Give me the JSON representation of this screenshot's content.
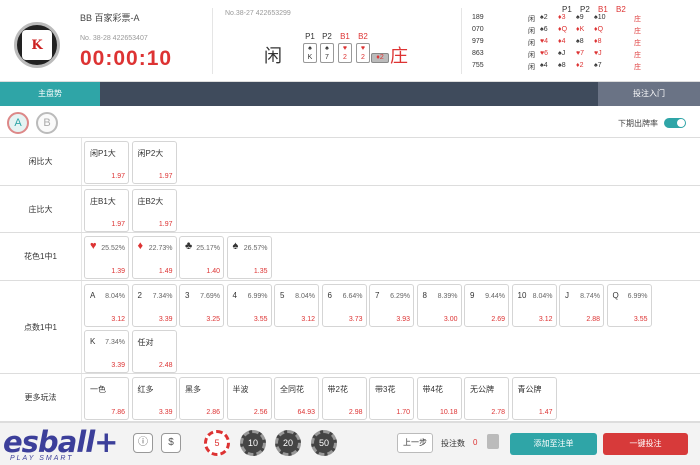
{
  "header": {
    "game_name": "BB 百家彩票-A",
    "game_no": "No. 38-28 422653407",
    "timer": "00:00:10",
    "prev_no": "No.38-27 422653299",
    "player_label": "闲",
    "banker_label": "庄",
    "cols": [
      "P1",
      "P2",
      "B1",
      "B2"
    ],
    "cards": [
      {
        "suit": "♠",
        "rank": "K",
        "color": "#333"
      },
      {
        "suit": "♠",
        "rank": "7",
        "color": "#333"
      },
      {
        "suit": "♥",
        "rank": "2",
        "color": "#d33"
      },
      {
        "suit": "♥",
        "rank": "2",
        "color": "#d33"
      },
      {
        "suit": "♦",
        "rank": "2",
        "color": "#d33"
      }
    ]
  },
  "history": {
    "cols": [
      "P1",
      "P2",
      "B1",
      "B2"
    ],
    "rows": [
      {
        "no": "189",
        "side": "闲",
        "cells": [
          "♠2",
          "♦3",
          "♠9",
          "♠10",
          "庄"
        ]
      },
      {
        "no": "070",
        "side": "闲",
        "cells": [
          "♠6",
          "♦Q",
          "♦K",
          "♦Q",
          "庄"
        ]
      },
      {
        "no": "979",
        "side": "闲",
        "cells": [
          "♥4",
          "♦4",
          "♠8",
          "♦8",
          "庄"
        ]
      },
      {
        "no": "863",
        "side": "闲",
        "cells": [
          "♥6",
          "♠J",
          "♥7",
          "♥J",
          "庄"
        ]
      },
      {
        "no": "755",
        "side": "闲",
        "cells": [
          "♠4",
          "♠8",
          "♦2",
          "♠7",
          "庄"
        ]
      }
    ]
  },
  "tabs": {
    "main": "主盘势",
    "entry": "投注入门"
  },
  "ab": {
    "a": "A",
    "b": "B",
    "next_label": "下期出牌率"
  },
  "rows": [
    {
      "label": "闲比大",
      "btns": [
        {
          "t": "闲P1大",
          "p": "",
          "o": "1.97"
        },
        {
          "t": "闲P2大",
          "p": "",
          "o": "1.97"
        }
      ]
    },
    {
      "label": "庄比大",
      "btns": [
        {
          "t": "庄B1大",
          "p": "",
          "o": "1.97"
        },
        {
          "t": "庄B2大",
          "p": "",
          "o": "1.97"
        }
      ]
    },
    {
      "label": "花色1中1",
      "btns": [
        {
          "t": "♥",
          "p": "25.52%",
          "o": "1.39",
          "c": "#d33"
        },
        {
          "t": "♦",
          "p": "22.73%",
          "o": "1.49",
          "c": "#d33"
        },
        {
          "t": "♣",
          "p": "25.17%",
          "o": "1.40",
          "c": "#333"
        },
        {
          "t": "♠",
          "p": "26.57%",
          "o": "1.35",
          "c": "#333"
        }
      ]
    },
    {
      "label": "点数1中1",
      "btns": [
        {
          "t": "A",
          "p": "8.04%",
          "o": "3.12"
        },
        {
          "t": "2",
          "p": "7.34%",
          "o": "3.39"
        },
        {
          "t": "3",
          "p": "7.69%",
          "o": "3.25"
        },
        {
          "t": "4",
          "p": "6.99%",
          "o": "3.55"
        },
        {
          "t": "5",
          "p": "8.04%",
          "o": "3.12"
        },
        {
          "t": "6",
          "p": "6.64%",
          "o": "3.73"
        },
        {
          "t": "7",
          "p": "6.29%",
          "o": "3.93"
        },
        {
          "t": "8",
          "p": "8.39%",
          "o": "3.00"
        },
        {
          "t": "9",
          "p": "9.44%",
          "o": "2.69"
        },
        {
          "t": "10",
          "p": "8.04%",
          "o": "3.12"
        },
        {
          "t": "J",
          "p": "8.74%",
          "o": "2.88"
        },
        {
          "t": "Q",
          "p": "6.99%",
          "o": "3.55"
        },
        {
          "t": "K",
          "p": "7.34%",
          "o": "3.39"
        },
        {
          "t": "任对",
          "p": "",
          "o": "2.48"
        }
      ]
    },
    {
      "label": "更多玩法",
      "btns": [
        {
          "t": "一色",
          "p": "",
          "o": "7.86"
        },
        {
          "t": "红多",
          "p": "",
          "o": "3.39"
        },
        {
          "t": "黑多",
          "p": "",
          "o": "2.86"
        },
        {
          "t": "半波",
          "p": "",
          "o": "2.56"
        },
        {
          "t": "全同花",
          "p": "",
          "o": "64.93"
        },
        {
          "t": "带2花",
          "p": "",
          "o": "2.98"
        },
        {
          "t": "带3花",
          "p": "",
          "o": "1.70"
        },
        {
          "t": "带4花",
          "p": "",
          "o": "10.18"
        },
        {
          "t": "无公牌",
          "p": "",
          "o": "2.78"
        },
        {
          "t": "青公牌",
          "p": "",
          "o": "1.47"
        }
      ]
    }
  ],
  "bottom": {
    "brand": "esball+",
    "brand_sub": "PLAY SMART",
    "chips": [
      "5",
      "10",
      "20",
      "50"
    ],
    "prev": "上一步",
    "bet_count_label": "投注数",
    "bet_count": "0",
    "add": "添加至注单",
    "all": "一键投注"
  }
}
